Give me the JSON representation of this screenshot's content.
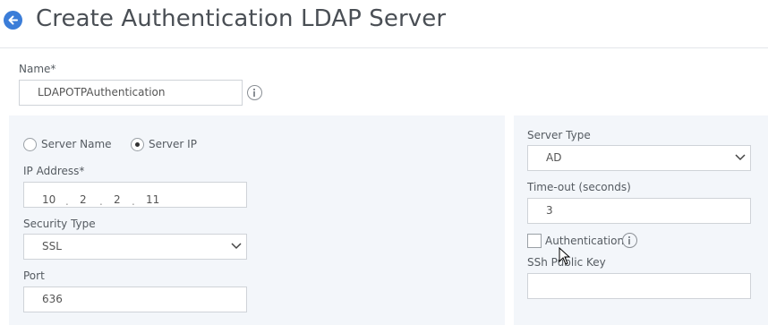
{
  "header": {
    "title": "Create Authentication LDAP Server"
  },
  "name": {
    "label": "Name*",
    "value": "LDAPOTPAuthentication"
  },
  "left": {
    "radio_server_name": "Server Name",
    "radio_server_ip": "Server IP",
    "ip_label": "IP Address*",
    "ip": [
      "10",
      "2",
      "2",
      "11"
    ],
    "ip_dots": [
      ".",
      ".",
      "."
    ],
    "security_label": "Security Type",
    "security_value": "SSL",
    "port_label": "Port",
    "port_value": "636"
  },
  "right": {
    "server_type_label": "Server Type",
    "server_type_value": "AD",
    "timeout_label": "Time-out (seconds)",
    "timeout_value": "3",
    "auth_label": "Authentication",
    "ssh_label": "SSh Public Key",
    "ssh_value": ""
  },
  "colors": {
    "accent": "#3b7dd8",
    "panel_bg": "#f3f6fa",
    "border": "#cfd3d8"
  }
}
